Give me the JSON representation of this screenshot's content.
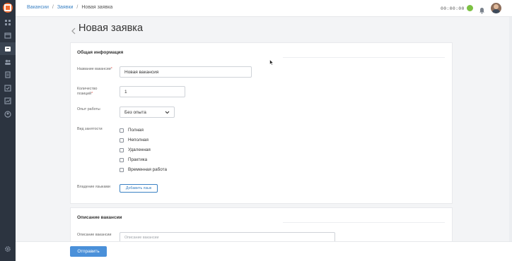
{
  "breadcrumb": {
    "items": [
      "Вакансии",
      "Заявки"
    ],
    "current": "Новая заявка",
    "separator": "/"
  },
  "header": {
    "timer": "00:00:00",
    "status_color": "#7cc142"
  },
  "sidebar": {
    "icons": [
      "dashboard-icon",
      "calendar-icon",
      "requests-icon",
      "users-icon",
      "documents-icon",
      "tests-icon",
      "analytics-icon",
      "profile-icon",
      "settings-icon"
    ]
  },
  "page": {
    "title": "Новая заявка"
  },
  "general": {
    "title": "Общая информация",
    "vacancy_name": {
      "label": "Название вакансии",
      "required": "*",
      "value": "Новая вакансия"
    },
    "positions": {
      "label": "Количество позиций",
      "required": "*",
      "value": "1"
    },
    "experience": {
      "label": "Опыт работы",
      "value": "Без опыта"
    },
    "employment": {
      "label": "Вид занятости",
      "options": [
        "Полная",
        "Неполная",
        "Удаленная",
        "Практика",
        "Временная работа"
      ]
    },
    "languages": {
      "label": "Владение языками",
      "button": "Добавить язык"
    }
  },
  "description": {
    "title": "Описание вакансии",
    "field": {
      "label": "Описание вакансии",
      "placeholder": "Описание вакансии"
    }
  },
  "footer": {
    "submit": "Отправить"
  },
  "colors": {
    "accent": "#4a90d9",
    "link": "#3b82c4",
    "sidebar": "#2c3440",
    "logo": "#f26b2f"
  }
}
